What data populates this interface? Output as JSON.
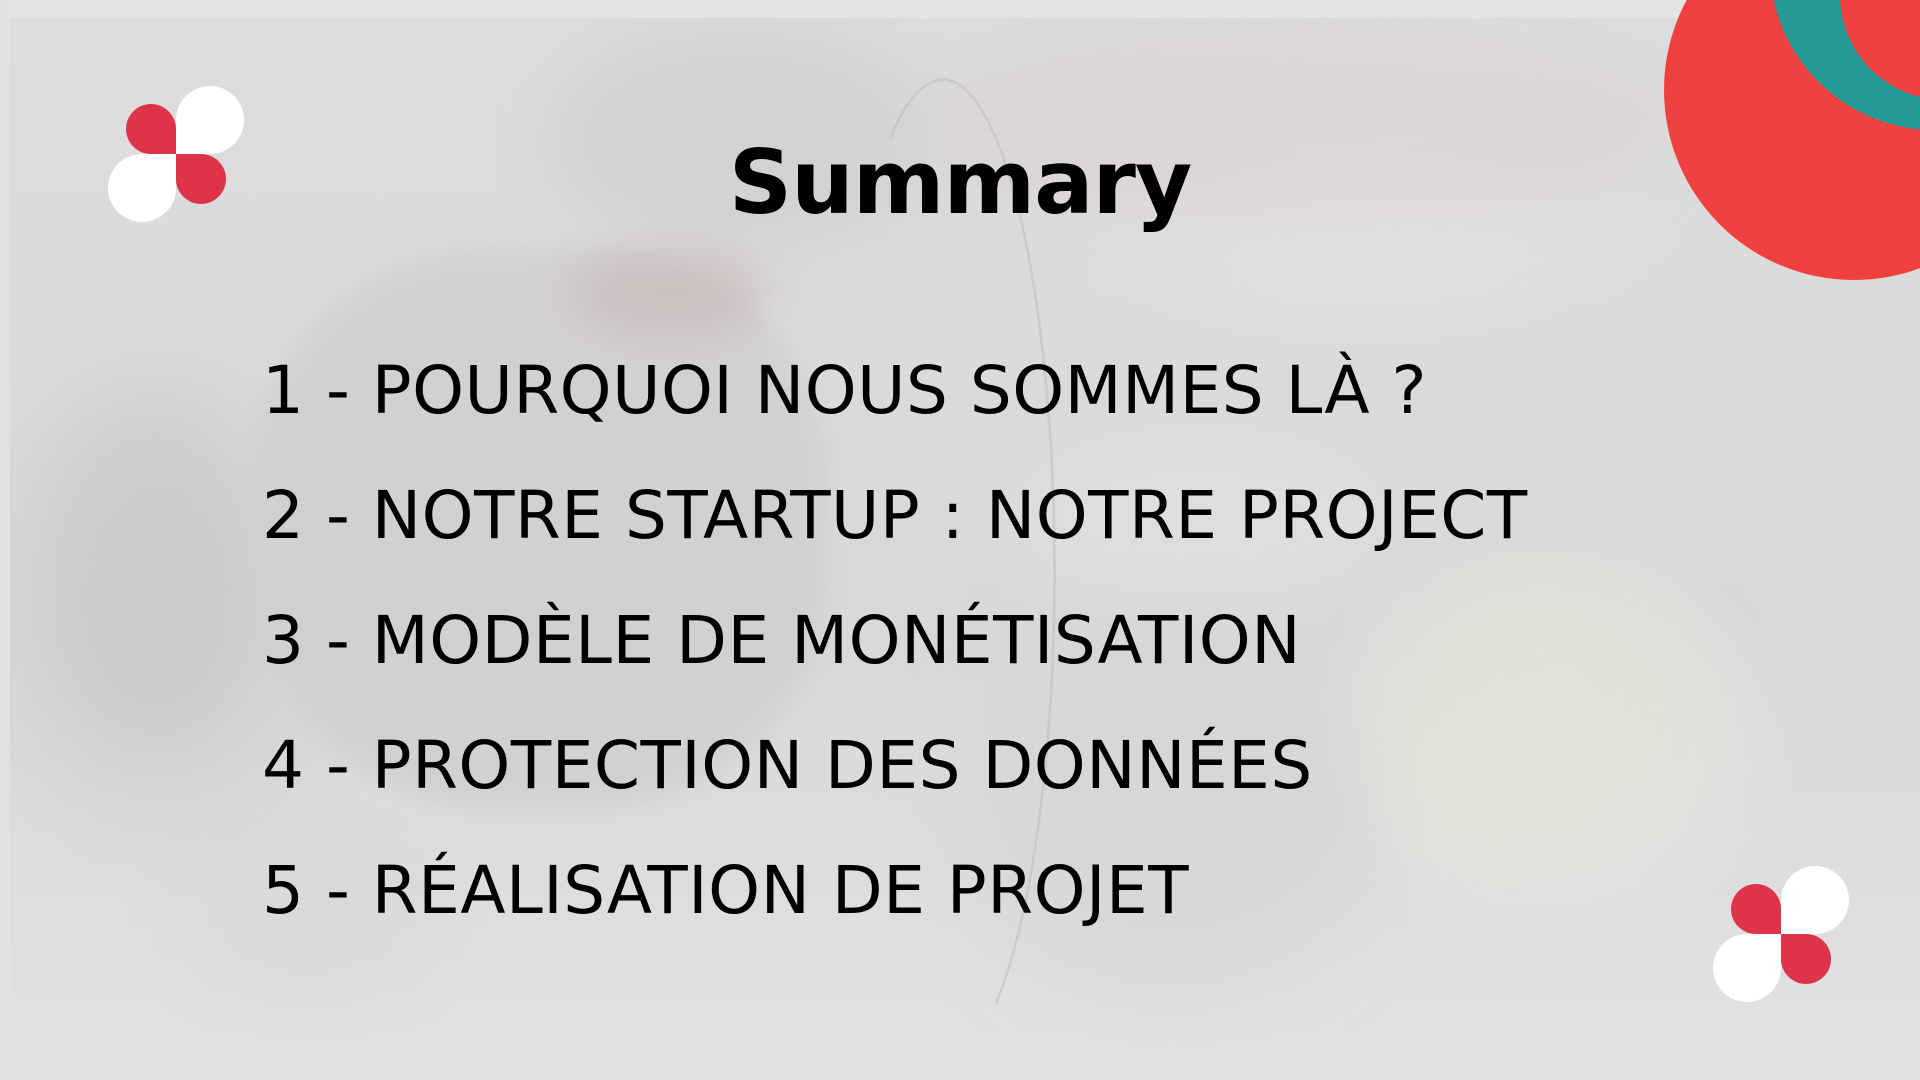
{
  "slide": {
    "title": "Summary",
    "items": [
      {
        "label": "1 - POURQUOI NOUS SOMMES LÀ ?"
      },
      {
        "label": "2 - NOTRE STARTUP : NOTRE PROJECT"
      },
      {
        "label": "3 - MODÈLE DE MONÉTISATION"
      },
      {
        "label": "4 - PROTECTION DES DONNÉES"
      },
      {
        "label": "5 - RÉALISATION DE PROJET"
      }
    ]
  },
  "colors": {
    "accent_red": "#de3449",
    "corner_red": "#f04141",
    "corner_teal": "#259a97",
    "text": "#000000"
  },
  "icons": {
    "logo": "four-petal-logo-icon"
  }
}
